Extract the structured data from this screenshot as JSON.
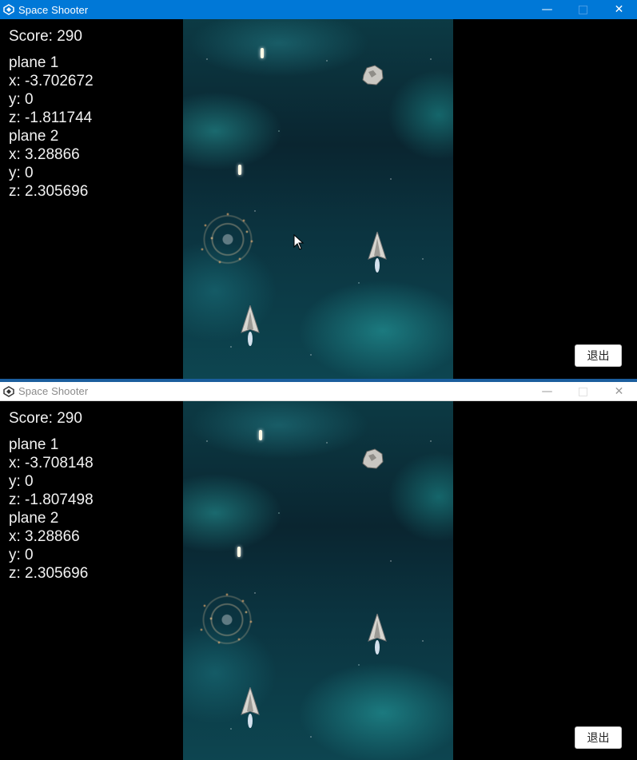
{
  "windows": [
    {
      "title": "Space Shooter",
      "state": "active",
      "hud": {
        "score": "Score: 290",
        "plane1_label": "plane 1",
        "plane1_x": "x: -3.702672",
        "plane1_y": "y: 0",
        "plane1_z": "z: -1.811744",
        "plane2_label": "plane 2",
        "plane2_x": "x: 3.28866",
        "plane2_y": "y: 0",
        "plane2_z": "z: 2.305696"
      },
      "exit_label": "退出"
    },
    {
      "title": "Space Shooter",
      "state": "inactive",
      "hud": {
        "score": "Score: 290",
        "plane1_label": "plane 1",
        "plane1_x": "x: -3.708148",
        "plane1_y": "y: 0",
        "plane1_z": "z: -1.807498",
        "plane2_label": "plane 2",
        "plane2_x": "x: 3.28866",
        "plane2_y": "y: 0",
        "plane2_z": "z: 2.305696"
      },
      "exit_label": "退出"
    }
  ],
  "window_controls": {
    "minimize_icon": "minimize-icon",
    "maximize_icon": "maximize-icon",
    "close_icon": "close-icon"
  },
  "colors": {
    "titlebar_active": "#0078d7",
    "titlebar_inactive": "#ffffff",
    "hud_text": "#f2f2f2",
    "nebula": "#0c3a44"
  }
}
